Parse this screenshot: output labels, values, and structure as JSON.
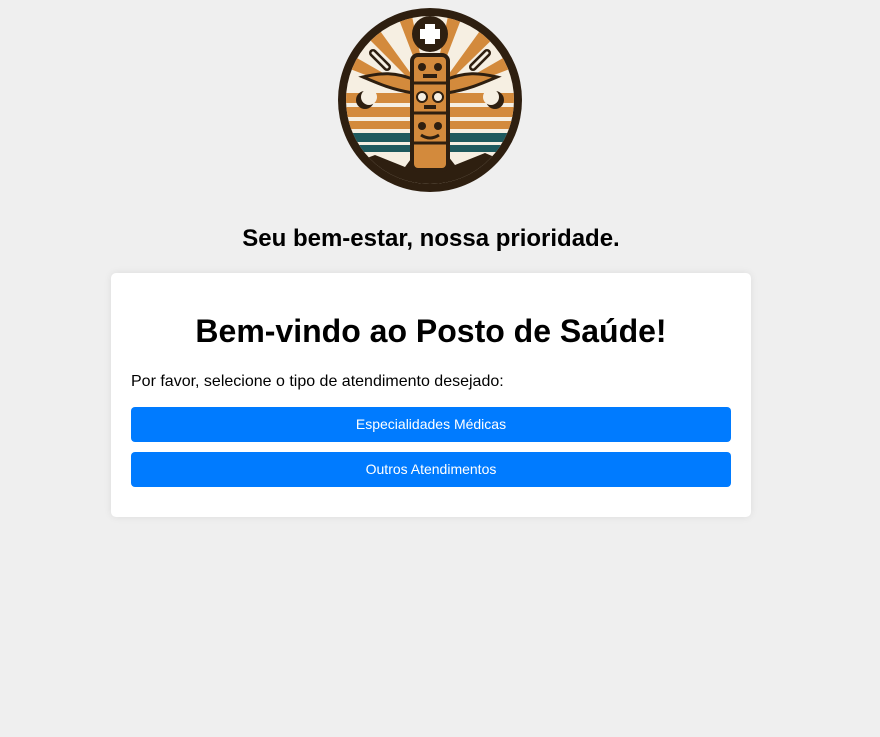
{
  "header": {
    "logo_icon": "totem-pole-medical-cross-logo",
    "tagline": "Seu bem-estar, nossa prioridade."
  },
  "card": {
    "title": "Bem-vindo ao Posto de Saúde!",
    "description": "Por favor, selecione o tipo de atendimento desejado:",
    "buttons": [
      {
        "label": "Especialidades Médicas"
      },
      {
        "label": "Outros Atendimentos"
      }
    ]
  },
  "colors": {
    "background": "#efefef",
    "card": "#ffffff",
    "button": "#007bff",
    "button_text": "#ffffff",
    "logo_dark": "#2e1f10",
    "logo_orange": "#d38a3c",
    "logo_teal": "#1f5a5e"
  }
}
